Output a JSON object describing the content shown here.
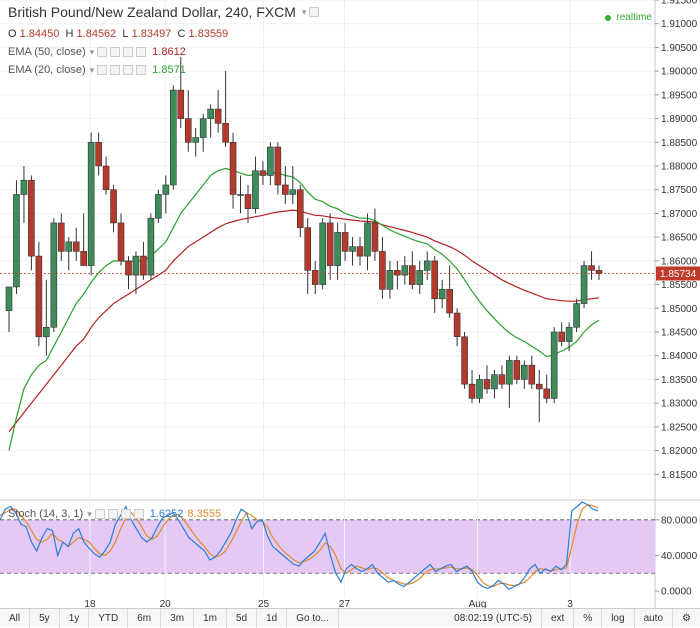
{
  "header": {
    "title": "British Pound/New Zealand Dollar, 240, FXCM",
    "ohlc": [
      {
        "key": "O",
        "value": "1.84450"
      },
      {
        "key": "H",
        "value": "1.84562"
      },
      {
        "key": "L",
        "value": "1.83497"
      },
      {
        "key": "C",
        "value": "1.83559"
      }
    ],
    "realtime": "realtime"
  },
  "indicators": [
    {
      "label": "EMA (50, close)",
      "value": "1.8612",
      "color": "#b22222"
    },
    {
      "label": "EMA (20, close)",
      "value": "1.8571",
      "color": "#2ca02c"
    }
  ],
  "stoch": {
    "label": "Stoch (14, 3, 1)",
    "k_value": "1.6252",
    "d_value": "8.3555",
    "k_color": "#2a7fd4",
    "d_color": "#e08a2b"
  },
  "price_axis": {
    "ticks": [
      "1.91500",
      "1.91000",
      "1.90500",
      "1.90000",
      "1.89500",
      "1.89000",
      "1.88500",
      "1.88000",
      "1.87500",
      "1.87000",
      "1.86500",
      "1.86000",
      "1.85500",
      "1.85000",
      "1.84500",
      "1.84000",
      "1.83500",
      "1.83000",
      "1.82500",
      "1.82000",
      "1.81500"
    ],
    "current_price": "1.85734",
    "current_label_color": "#c0392b"
  },
  "stoch_axis": {
    "ticks": [
      "80.0000",
      "40.0000",
      "0.0000"
    ]
  },
  "time_axis": {
    "labels": [
      "18",
      "20",
      "25",
      "27",
      "Aug",
      "3"
    ]
  },
  "toolbar": {
    "ranges": [
      "All",
      "5y",
      "1y",
      "YTD",
      "6m",
      "3m",
      "1m",
      "5d",
      "1d"
    ],
    "goto": "Go to...",
    "clock": "08:02:19 (UTC-5)",
    "ext": "ext",
    "pct": "%",
    "log": "log",
    "auto": "auto"
  },
  "colors": {
    "up": "#3d8c5a",
    "down": "#b33a2d",
    "ema50": "#b22222",
    "ema20": "#2ca02c",
    "stoch_band": "#e4c8f5"
  },
  "chart_data": [
    {
      "type": "candlestick",
      "title": "British Pound/New Zealand Dollar, 240, FXCM",
      "x_labels": [
        "18",
        "20",
        "25",
        "27",
        "Aug",
        "3"
      ],
      "ylim": [
        1.81,
        1.915
      ],
      "grid": true,
      "candles": [
        {
          "o": 1.8495,
          "h": 1.853,
          "l": 1.845,
          "c": 1.8545
        },
        {
          "o": 1.8545,
          "h": 1.877,
          "l": 1.853,
          "c": 1.874
        },
        {
          "o": 1.874,
          "h": 1.88,
          "l": 1.868,
          "c": 1.877
        },
        {
          "o": 1.877,
          "h": 1.878,
          "l": 1.858,
          "c": 1.861
        },
        {
          "o": 1.861,
          "h": 1.864,
          "l": 1.842,
          "c": 1.844
        },
        {
          "o": 1.844,
          "h": 1.856,
          "l": 1.84,
          "c": 1.846
        },
        {
          "o": 1.846,
          "h": 1.869,
          "l": 1.845,
          "c": 1.868
        },
        {
          "o": 1.868,
          "h": 1.87,
          "l": 1.86,
          "c": 1.862
        },
        {
          "o": 1.862,
          "h": 1.865,
          "l": 1.858,
          "c": 1.864
        },
        {
          "o": 1.864,
          "h": 1.867,
          "l": 1.86,
          "c": 1.862
        },
        {
          "o": 1.862,
          "h": 1.87,
          "l": 1.859,
          "c": 1.859
        },
        {
          "o": 1.859,
          "h": 1.887,
          "l": 1.857,
          "c": 1.885
        },
        {
          "o": 1.885,
          "h": 1.887,
          "l": 1.878,
          "c": 1.88
        },
        {
          "o": 1.88,
          "h": 1.882,
          "l": 1.874,
          "c": 1.875
        },
        {
          "o": 1.875,
          "h": 1.876,
          "l": 1.866,
          "c": 1.868
        },
        {
          "o": 1.868,
          "h": 1.87,
          "l": 1.859,
          "c": 1.86
        },
        {
          "o": 1.86,
          "h": 1.861,
          "l": 1.854,
          "c": 1.857
        },
        {
          "o": 1.857,
          "h": 1.862,
          "l": 1.853,
          "c": 1.861
        },
        {
          "o": 1.861,
          "h": 1.864,
          "l": 1.856,
          "c": 1.857
        },
        {
          "o": 1.857,
          "h": 1.87,
          "l": 1.856,
          "c": 1.869
        },
        {
          "o": 1.869,
          "h": 1.875,
          "l": 1.868,
          "c": 1.874
        },
        {
          "o": 1.874,
          "h": 1.878,
          "l": 1.87,
          "c": 1.876
        },
        {
          "o": 1.876,
          "h": 1.897,
          "l": 1.875,
          "c": 1.896
        },
        {
          "o": 1.896,
          "h": 1.903,
          "l": 1.888,
          "c": 1.89
        },
        {
          "o": 1.89,
          "h": 1.896,
          "l": 1.883,
          "c": 1.885
        },
        {
          "o": 1.885,
          "h": 1.888,
          "l": 1.882,
          "c": 1.886
        },
        {
          "o": 1.886,
          "h": 1.891,
          "l": 1.883,
          "c": 1.89
        },
        {
          "o": 1.89,
          "h": 1.893,
          "l": 1.886,
          "c": 1.892
        },
        {
          "o": 1.892,
          "h": 1.896,
          "l": 1.887,
          "c": 1.889
        },
        {
          "o": 1.889,
          "h": 1.9,
          "l": 1.884,
          "c": 1.885
        },
        {
          "o": 1.885,
          "h": 1.887,
          "l": 1.871,
          "c": 1.874
        },
        {
          "o": 1.874,
          "h": 1.878,
          "l": 1.87,
          "c": 1.874
        },
        {
          "o": 1.874,
          "h": 1.876,
          "l": 1.868,
          "c": 1.871
        },
        {
          "o": 1.871,
          "h": 1.882,
          "l": 1.87,
          "c": 1.879
        },
        {
          "o": 1.879,
          "h": 1.881,
          "l": 1.876,
          "c": 1.878
        },
        {
          "o": 1.878,
          "h": 1.885,
          "l": 1.876,
          "c": 1.884
        },
        {
          "o": 1.884,
          "h": 1.885,
          "l": 1.874,
          "c": 1.876
        },
        {
          "o": 1.876,
          "h": 1.88,
          "l": 1.872,
          "c": 1.874
        },
        {
          "o": 1.874,
          "h": 1.88,
          "l": 1.872,
          "c": 1.875
        },
        {
          "o": 1.875,
          "h": 1.876,
          "l": 1.865,
          "c": 1.867
        },
        {
          "o": 1.867,
          "h": 1.869,
          "l": 1.853,
          "c": 1.858
        },
        {
          "o": 1.858,
          "h": 1.86,
          "l": 1.853,
          "c": 1.855
        },
        {
          "o": 1.855,
          "h": 1.869,
          "l": 1.854,
          "c": 1.868
        },
        {
          "o": 1.868,
          "h": 1.87,
          "l": 1.856,
          "c": 1.859
        },
        {
          "o": 1.859,
          "h": 1.868,
          "l": 1.856,
          "c": 1.866
        },
        {
          "o": 1.866,
          "h": 1.868,
          "l": 1.86,
          "c": 1.862
        },
        {
          "o": 1.862,
          "h": 1.865,
          "l": 1.859,
          "c": 1.863
        },
        {
          "o": 1.863,
          "h": 1.865,
          "l": 1.859,
          "c": 1.861
        },
        {
          "o": 1.861,
          "h": 1.87,
          "l": 1.858,
          "c": 1.868
        },
        {
          "o": 1.868,
          "h": 1.871,
          "l": 1.86,
          "c": 1.862
        },
        {
          "o": 1.862,
          "h": 1.865,
          "l": 1.852,
          "c": 1.854
        },
        {
          "o": 1.854,
          "h": 1.86,
          "l": 1.852,
          "c": 1.858
        },
        {
          "o": 1.858,
          "h": 1.86,
          "l": 1.854,
          "c": 1.857
        },
        {
          "o": 1.857,
          "h": 1.861,
          "l": 1.855,
          "c": 1.859
        },
        {
          "o": 1.859,
          "h": 1.862,
          "l": 1.854,
          "c": 1.855
        },
        {
          "o": 1.855,
          "h": 1.86,
          "l": 1.853,
          "c": 1.858
        },
        {
          "o": 1.858,
          "h": 1.862,
          "l": 1.856,
          "c": 1.86
        },
        {
          "o": 1.86,
          "h": 1.861,
          "l": 1.849,
          "c": 1.852
        },
        {
          "o": 1.852,
          "h": 1.856,
          "l": 1.85,
          "c": 1.854
        },
        {
          "o": 1.854,
          "h": 1.859,
          "l": 1.848,
          "c": 1.849
        },
        {
          "o": 1.849,
          "h": 1.85,
          "l": 1.842,
          "c": 1.844
        },
        {
          "o": 1.844,
          "h": 1.845,
          "l": 1.833,
          "c": 1.834
        },
        {
          "o": 1.834,
          "h": 1.837,
          "l": 1.83,
          "c": 1.831
        },
        {
          "o": 1.831,
          "h": 1.836,
          "l": 1.83,
          "c": 1.835
        },
        {
          "o": 1.835,
          "h": 1.838,
          "l": 1.832,
          "c": 1.833
        },
        {
          "o": 1.833,
          "h": 1.837,
          "l": 1.831,
          "c": 1.836
        },
        {
          "o": 1.836,
          "h": 1.838,
          "l": 1.833,
          "c": 1.834
        },
        {
          "o": 1.834,
          "h": 1.84,
          "l": 1.829,
          "c": 1.839
        },
        {
          "o": 1.839,
          "h": 1.84,
          "l": 1.834,
          "c": 1.835
        },
        {
          "o": 1.835,
          "h": 1.839,
          "l": 1.833,
          "c": 1.838
        },
        {
          "o": 1.838,
          "h": 1.84,
          "l": 1.833,
          "c": 1.834
        },
        {
          "o": 1.834,
          "h": 1.837,
          "l": 1.826,
          "c": 1.833
        },
        {
          "o": 1.833,
          "h": 1.836,
          "l": 1.83,
          "c": 1.831
        },
        {
          "o": 1.831,
          "h": 1.846,
          "l": 1.83,
          "c": 1.845
        },
        {
          "o": 1.845,
          "h": 1.847,
          "l": 1.842,
          "c": 1.843
        },
        {
          "o": 1.843,
          "h": 1.847,
          "l": 1.841,
          "c": 1.846
        },
        {
          "o": 1.846,
          "h": 1.852,
          "l": 1.845,
          "c": 1.851
        },
        {
          "o": 1.851,
          "h": 1.86,
          "l": 1.85,
          "c": 1.859
        },
        {
          "o": 1.859,
          "h": 1.862,
          "l": 1.856,
          "c": 1.858
        },
        {
          "o": 1.858,
          "h": 1.859,
          "l": 1.856,
          "c": 1.8573
        }
      ],
      "series": [
        {
          "name": "EMA (50, close)",
          "values": [
            1.824,
            1.826,
            1.828,
            1.83,
            1.832,
            1.834,
            1.836,
            1.838,
            1.84,
            1.842,
            1.8435,
            1.846,
            1.848,
            1.8495,
            1.851,
            1.852,
            1.853,
            1.854,
            1.855,
            1.856,
            1.857,
            1.858,
            1.86,
            1.8615,
            1.863,
            1.864,
            1.865,
            1.866,
            1.867,
            1.8678,
            1.8683,
            1.8687,
            1.869,
            1.8693,
            1.8696,
            1.87,
            1.8703,
            1.8705,
            1.8707,
            1.8705,
            1.87,
            1.8696,
            1.8695,
            1.8692,
            1.869,
            1.8688,
            1.8686,
            1.8684,
            1.8683,
            1.8682,
            1.8676,
            1.8672,
            1.8668,
            1.8664,
            1.866,
            1.8655,
            1.865,
            1.8642,
            1.8636,
            1.863,
            1.8622,
            1.8612,
            1.86,
            1.859,
            1.858,
            1.857,
            1.856,
            1.8552,
            1.8545,
            1.8538,
            1.8532,
            1.8526,
            1.852,
            1.8518,
            1.8516,
            1.8515,
            1.8515,
            1.8518,
            1.852,
            1.8522
          ]
        },
        {
          "name": "EMA (20, close)",
          "values": [
            1.82,
            1.827,
            1.833,
            1.836,
            1.838,
            1.839,
            1.842,
            1.845,
            1.848,
            1.851,
            1.853,
            1.8555,
            1.8575,
            1.859,
            1.86,
            1.86,
            1.8598,
            1.86,
            1.86,
            1.861,
            1.8625,
            1.864,
            1.867,
            1.87,
            1.872,
            1.874,
            1.876,
            1.878,
            1.879,
            1.8795,
            1.879,
            1.8785,
            1.878,
            1.8782,
            1.8782,
            1.8786,
            1.8785,
            1.878,
            1.8777,
            1.8765,
            1.8745,
            1.873,
            1.8725,
            1.8715,
            1.871,
            1.87,
            1.8695,
            1.869,
            1.869,
            1.8685,
            1.8675,
            1.8665,
            1.8658,
            1.8652,
            1.8645,
            1.864,
            1.8636,
            1.8624,
            1.8614,
            1.86,
            1.8583,
            1.856,
            1.8536,
            1.8515,
            1.8495,
            1.8478,
            1.8462,
            1.8448,
            1.8438,
            1.843,
            1.842,
            1.841,
            1.8398,
            1.8403,
            1.841,
            1.8418,
            1.843,
            1.845,
            1.8465,
            1.8475
          ]
        }
      ]
    },
    {
      "type": "line",
      "title": "Stoch (14, 3, 1)",
      "ylim": [
        -10,
        100
      ],
      "band": [
        20,
        80
      ],
      "series": [
        {
          "name": "%K",
          "values": [
            80,
            92,
            95,
            88,
            75,
            72,
            55,
            45,
            60,
            70,
            68,
            40,
            55,
            50,
            65,
            70,
            55,
            48,
            42,
            38,
            45,
            55,
            75,
            85,
            95,
            80,
            70,
            60,
            55,
            60,
            72,
            82,
            85,
            88,
            80,
            70,
            60,
            55,
            50,
            45,
            35,
            38,
            45,
            55,
            65,
            80,
            92,
            88,
            70,
            78,
            80,
            62,
            50,
            45,
            40,
            35,
            30,
            28,
            35,
            40,
            45,
            55,
            65,
            40,
            20,
            10,
            25,
            30,
            25,
            22,
            25,
            30,
            20,
            15,
            10,
            12,
            8,
            5,
            10,
            15,
            20,
            25,
            30,
            22,
            25,
            28,
            30,
            22,
            25,
            28,
            22,
            10,
            5,
            3,
            6,
            12,
            8,
            2,
            5,
            8,
            15,
            25,
            30,
            20,
            25,
            22,
            28,
            24,
            30,
            90,
            95,
            100,
            97,
            92,
            90
          ]
        },
        {
          "name": "%D",
          "values": [
            85,
            88,
            92,
            92,
            85,
            78,
            68,
            58,
            55,
            58,
            65,
            58,
            55,
            50,
            55,
            60,
            58,
            55,
            48,
            42,
            40,
            45,
            55,
            70,
            82,
            88,
            82,
            72,
            62,
            58,
            62,
            72,
            80,
            85,
            86,
            80,
            72,
            64,
            56,
            50,
            42,
            38,
            40,
            45,
            55,
            66,
            78,
            88,
            85,
            80,
            78,
            72,
            60,
            52,
            45,
            40,
            35,
            32,
            33,
            36,
            40,
            46,
            54,
            50,
            40,
            25,
            20,
            24,
            28,
            26,
            24,
            26,
            25,
            20,
            15,
            12,
            10,
            8,
            8,
            10,
            14,
            20,
            24,
            25,
            25,
            26,
            27,
            25,
            25,
            26,
            24,
            18,
            10,
            6,
            5,
            8,
            9,
            7,
            6,
            8,
            10,
            15,
            22,
            25,
            24,
            23,
            24,
            25,
            26,
            50,
            75,
            92,
            97,
            96,
            93
          ]
        }
      ]
    }
  ]
}
